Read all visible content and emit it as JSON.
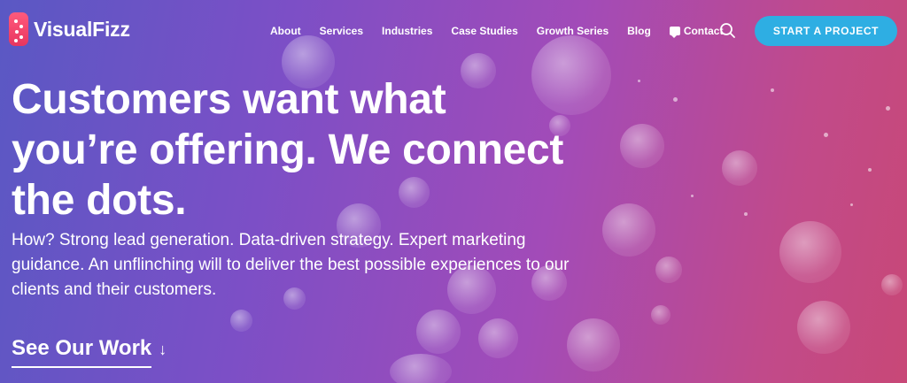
{
  "brand": {
    "name": "VisualFizz"
  },
  "nav": {
    "items": [
      {
        "label": "About"
      },
      {
        "label": "Services"
      },
      {
        "label": "Industries"
      },
      {
        "label": "Case Studies"
      },
      {
        "label": "Growth Series"
      },
      {
        "label": "Blog"
      },
      {
        "label": "Contact"
      }
    ]
  },
  "header": {
    "cta_label": "START A PROJECT"
  },
  "hero": {
    "title_line1": "Customers want what",
    "title_line2": "you’re offering. We connect",
    "title_line3": "the dots.",
    "subtitle": "How? Strong lead generation. Data-driven strategy. Expert marketing guidance. An unflinching will to deliver the best possible experiences to our clients and their customers.",
    "see_work_label": "See Our Work",
    "see_work_arrow": "↓"
  },
  "colors": {
    "cta": "#2eaee3",
    "gradient_start": "#5a58c4",
    "gradient_end": "#c84877",
    "logo": "#ff5a7d"
  },
  "icons": {
    "search": "search-icon",
    "chat": "chat-icon",
    "arrow": "arrow-down-icon"
  }
}
